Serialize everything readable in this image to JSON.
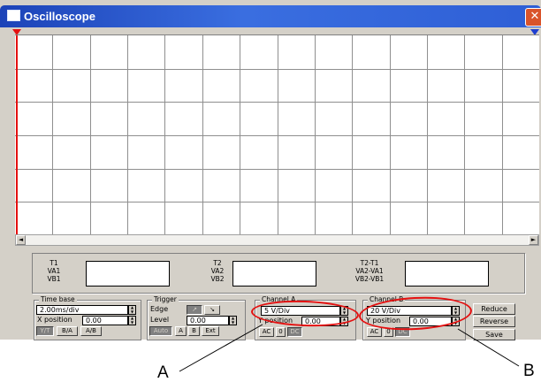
{
  "window": {
    "title": "Oscilloscope",
    "close_glyph": "✕"
  },
  "readouts": [
    {
      "names": [
        "T1",
        "VA1",
        "VB1"
      ],
      "value": ""
    },
    {
      "names": [
        "T2",
        "VA2",
        "VB2"
      ],
      "value": ""
    },
    {
      "names": [
        "T2-T1",
        "VA2-VA1",
        "VB2-VB1"
      ],
      "value": ""
    }
  ],
  "time_base": {
    "title": "Time base",
    "scale": "2.00ms/div",
    "position_label": "X position",
    "position": "0.00",
    "modes": [
      "Y/T",
      "B/A",
      "A/B"
    ],
    "active_mode": "Y/T"
  },
  "trigger": {
    "title": "Trigger",
    "edge_label": "Edge",
    "edge_rising": "↗",
    "edge_falling": "↘",
    "level_label": "Level",
    "level": "0.00",
    "modes": [
      "Auto",
      "A",
      "B",
      "Ext"
    ],
    "active_mode": "Auto"
  },
  "channel_a": {
    "title": "Channel A",
    "scale": "5  V/Div",
    "position_label": "Y position",
    "position": "0.00",
    "couplings": [
      "AC",
      "0",
      "DC"
    ],
    "active_coupling": "DC"
  },
  "channel_b": {
    "title": "Channel B",
    "scale": "20  V/Div",
    "position_label": "Y position",
    "position": "0.00",
    "couplings": [
      "AC",
      "0",
      "DC"
    ],
    "active_coupling": "DC"
  },
  "actions": {
    "reduce": "Reduce",
    "reverse": "Reverse",
    "save": "Save"
  },
  "scrollbar": {
    "left_arrow": "◄",
    "right_arrow": "►"
  },
  "annotations": {
    "a": "A",
    "b": "B"
  },
  "colors": {
    "title_bar": "#2e5fd6",
    "trace_a": "#e41010",
    "trace_b": "#1f3fd0",
    "grid": "#8f8f8f",
    "highlight": "#e41010"
  }
}
